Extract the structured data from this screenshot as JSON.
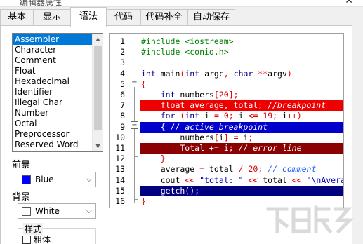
{
  "window": {
    "title": "编辑器属性",
    "close_glyph": "✕"
  },
  "tabs": [
    {
      "label": "基本",
      "active": false
    },
    {
      "label": "显示",
      "active": false
    },
    {
      "label": "语法",
      "active": true
    },
    {
      "label": "代码",
      "active": false
    },
    {
      "label": "代码补全",
      "active": false
    },
    {
      "label": "自动保存",
      "active": false
    }
  ],
  "syntax_list": {
    "items": [
      "Assembler",
      "Character",
      "Comment",
      "Float",
      "Hexadecimal",
      "Identifier",
      "Illegal Char",
      "Number",
      "Octal",
      "Preprocessor",
      "Reserved Word"
    ],
    "selected": "Assembler"
  },
  "foreground": {
    "label": "前景",
    "value": "Blue",
    "color": "#0000ff"
  },
  "background": {
    "label": "背景",
    "value": "White",
    "color": "#ffffff"
  },
  "style": {
    "label": "样式",
    "bold_label": "粗体"
  },
  "editor": {
    "highlight_colors": {
      "breakpoint": "#ee0000",
      "active_breakpoint": "#0000cc",
      "error_line": "#8b0000",
      "execution": "#000080"
    },
    "lines": [
      {
        "num": "1",
        "text": "#include <iostream>"
      },
      {
        "num": "2",
        "text": "#include <conio.h>"
      },
      {
        "num": "3",
        "text": ""
      },
      {
        "num": "4",
        "text": "int main(int argc, char **argv)"
      },
      {
        "num": "5",
        "text": "{"
      },
      {
        "num": "6",
        "text": "    int numbers[20];"
      },
      {
        "num": "7",
        "text": "    float average, total; //breakpoint"
      },
      {
        "num": "8",
        "text": "    for (int i = 0; i <= 19; i++)"
      },
      {
        "num": "9",
        "text": "    { // active breakpoint"
      },
      {
        "num": "10",
        "text": "        numbers[i] = i;"
      },
      {
        "num": "11",
        "text": "        Total += i; // error line"
      },
      {
        "num": "12",
        "text": "    }"
      },
      {
        "num": "13",
        "text": "    average = total / 20; // comment"
      },
      {
        "num": "14",
        "text": "    cout << \"total: \" << total << \"\\nAverage: \";"
      },
      {
        "num": "15",
        "text": "    getch();"
      },
      {
        "num": "16",
        "text": "}"
      }
    ]
  }
}
